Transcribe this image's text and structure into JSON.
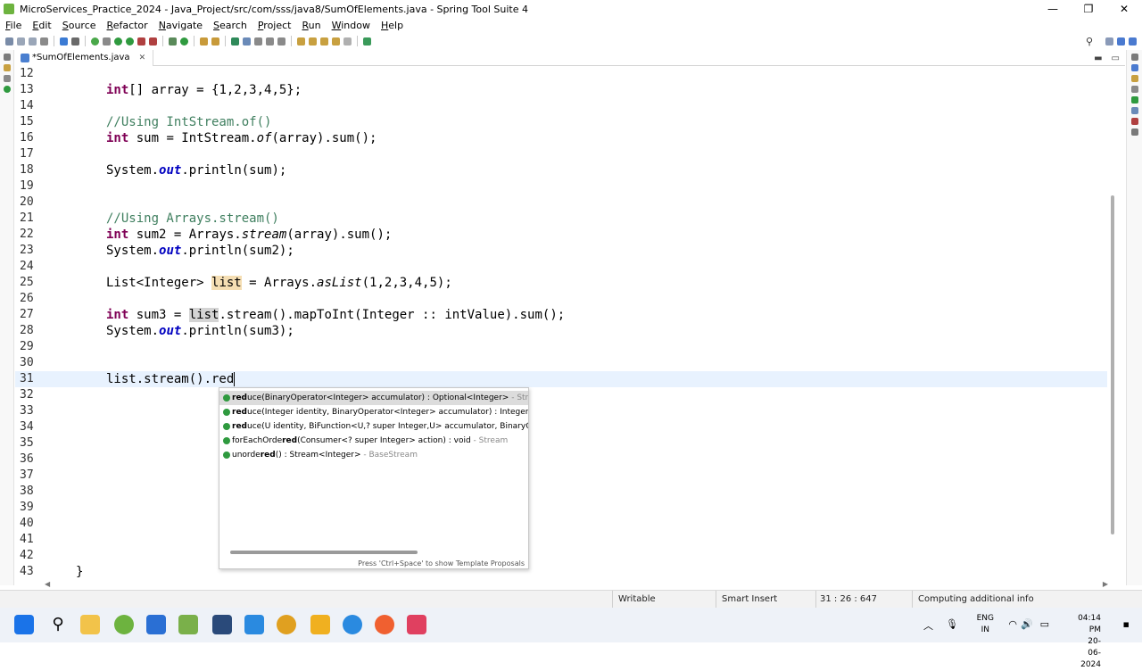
{
  "window": {
    "title": "MicroServices_Practice_2024 - Java_Project/src/com/sss/java8/SumOfElements.java - Spring Tool Suite 4",
    "minimize": "—",
    "maximize": "❐",
    "close": "✕"
  },
  "menu": [
    "File",
    "Edit",
    "Source",
    "Refactor",
    "Navigate",
    "Search",
    "Project",
    "Run",
    "Window",
    "Help"
  ],
  "editor": {
    "tab_label": "*SumOfElements.java",
    "tab_close": "✕",
    "lines": [
      {
        "n": "12",
        "code": ""
      },
      {
        "n": "13",
        "code": "int[] array = {1,2,3,4,5};"
      },
      {
        "n": "14",
        "code": ""
      },
      {
        "n": "15",
        "code": "//Using IntStream.of()"
      },
      {
        "n": "16",
        "code": "int sum = IntStream.of(array).sum();"
      },
      {
        "n": "17",
        "code": ""
      },
      {
        "n": "18",
        "code": "System.out.println(sum);"
      },
      {
        "n": "19",
        "code": ""
      },
      {
        "n": "20",
        "code": ""
      },
      {
        "n": "21",
        "code": "//Using Arrays.stream()"
      },
      {
        "n": "22",
        "code": "int sum2 = Arrays.stream(array).sum();"
      },
      {
        "n": "23",
        "code": "System.out.println(sum2);"
      },
      {
        "n": "24",
        "code": ""
      },
      {
        "n": "25",
        "code": "List<Integer> list = Arrays.asList(1,2,3,4,5);"
      },
      {
        "n": "26",
        "code": ""
      },
      {
        "n": "27",
        "code": "int sum3 = list.stream().mapToInt(Integer :: intValue).sum();"
      },
      {
        "n": "28",
        "code": "System.out.println(sum3);"
      },
      {
        "n": "29",
        "code": ""
      },
      {
        "n": "30",
        "code": ""
      },
      {
        "n": "31",
        "code": "list.stream().red"
      },
      {
        "n": "32",
        "code": ""
      },
      {
        "n": "33",
        "code": ""
      },
      {
        "n": "34",
        "code": ""
      },
      {
        "n": "35",
        "code": ""
      },
      {
        "n": "36",
        "code": ""
      },
      {
        "n": "37",
        "code": ""
      },
      {
        "n": "38",
        "code": ""
      },
      {
        "n": "39",
        "code": ""
      },
      {
        "n": "40",
        "code": ""
      },
      {
        "n": "41",
        "code": ""
      },
      {
        "n": "42",
        "code": ""
      },
      {
        "n": "43",
        "code": "}"
      }
    ],
    "current_line": "31"
  },
  "content_assist": {
    "proposals": [
      {
        "match": "red",
        "rest": "uce(BinaryOperator<Integer> accumulator) : Optional<Integer>",
        "owner": " - Stream"
      },
      {
        "match": "red",
        "rest": "uce(Integer identity, BinaryOperator<Integer> accumulator) : Integer",
        "owner": " - Stream"
      },
      {
        "match": "red",
        "rest": "uce(U identity, BiFunction<U,? super Integer,U> accumulator, BinaryOperator<U> combiner) : U",
        "owner": " - Stream"
      },
      {
        "pre": "forEachOrde",
        "match": "red",
        "rest": "(Consumer<? super Integer> action) : void",
        "owner": " - Stream"
      },
      {
        "pre": "unorde",
        "match": "red",
        "rest": "() : Stream<Integer>",
        "owner": " - BaseStream"
      }
    ],
    "footer": "Press 'Ctrl+Space' to show Template Proposals"
  },
  "status": {
    "writable": "Writable",
    "insert_mode": "Smart Insert",
    "position": "31 : 26 : 647",
    "progress": "Computing additional info"
  },
  "taskbar": {
    "lang_top": "ENG",
    "lang_bottom": "IN",
    "time": "04:14 PM",
    "date": "20-06-2024"
  },
  "colors": {
    "keyword": "#7f0055",
    "comment": "#3f7f5f",
    "field": "#0000c0",
    "current_line": "#e8f2fe",
    "occurrence": "#f5deb3"
  }
}
